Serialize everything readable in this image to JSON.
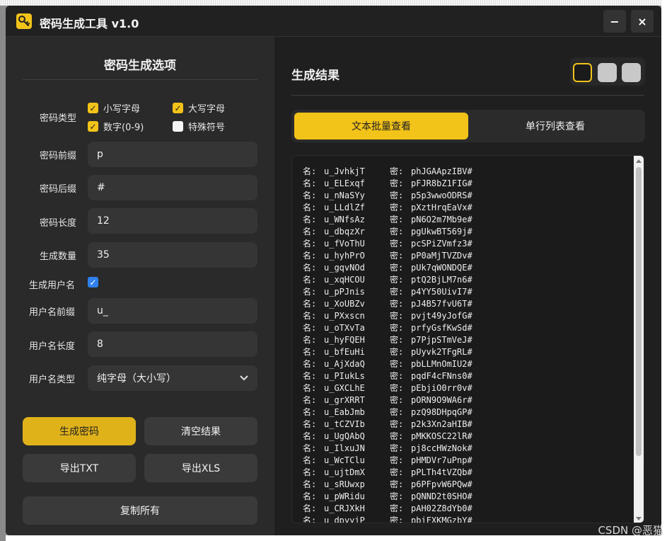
{
  "window": {
    "title": "密码生成工具 v1.0",
    "minimize": "−",
    "close": "×"
  },
  "left": {
    "title": "密码生成选项",
    "password_type_label": "密码类型",
    "checkboxes": [
      {
        "label": "小写字母",
        "checked": true
      },
      {
        "label": "大写字母",
        "checked": true
      },
      {
        "label": "数字(0-9)",
        "checked": true
      },
      {
        "label": "特殊符号",
        "checked": false
      }
    ],
    "fields": {
      "prefix_label": "密码前缀",
      "prefix_value": "p",
      "suffix_label": "密码后缀",
      "suffix_value": "#",
      "length_label": "密码长度",
      "length_value": "12",
      "count_label": "生成数量",
      "count_value": "35",
      "gen_username_label": "生成用户名",
      "gen_username_checked": true,
      "username_prefix_label": "用户名前缀",
      "username_prefix_value": "u_",
      "username_length_label": "用户名长度",
      "username_length_value": "8",
      "username_type_label": "用户名类型",
      "username_type_value": "纯字母（大小写）"
    },
    "buttons": {
      "generate": "生成密码",
      "clear": "清空结果",
      "export_txt": "导出TXT",
      "export_xls": "导出XLS",
      "copy_all": "复制所有"
    }
  },
  "right": {
    "title": "生成结果",
    "tabs": [
      "文本批量查看",
      "单行列表查看"
    ],
    "username_prefix": "名:",
    "password_prefix": "密:",
    "results": [
      [
        "u_JvhkjT",
        "phJGAApzIBV#"
      ],
      [
        "u_ELExqf",
        "pFJR8bZ1FIG#"
      ],
      [
        "u_nNaSYy",
        "p5p3wwoODRS#"
      ],
      [
        "u_LLdlZf",
        "pXztHrqEaVx#"
      ],
      [
        "u_WNfsAz",
        "pN6O2m7Mb9e#"
      ],
      [
        "u_dbqzXr",
        "pgUkwBT569j#"
      ],
      [
        "u_fVoThU",
        "pcSPiZVmfz3#"
      ],
      [
        "u_hyhPrO",
        "pP0aMjTVZDv#"
      ],
      [
        "u_gqvNOd",
        "pUk7qWONDQE#"
      ],
      [
        "u_xqHCOU",
        "ptQ2BjLM7n6#"
      ],
      [
        "u_pPJnis",
        "p4YY50UivI7#"
      ],
      [
        "u_XoUBZv",
        "pJ4B57fvU6T#"
      ],
      [
        "u_PXxscn",
        "pvjt49yJofG#"
      ],
      [
        "u_oTXvTa",
        "prfyGsfKwSd#"
      ],
      [
        "u_hyFQEH",
        "p7PjpSTmVeJ#"
      ],
      [
        "u_bfEuHi",
        "pUyvk2TFgRL#"
      ],
      [
        "u_AjXdaQ",
        "pbLLMnOmIU2#"
      ],
      [
        "u_PIukLs",
        "pqdF4cFNns0#"
      ],
      [
        "u_GXCLhE",
        "pEbjiO0rr0v#"
      ],
      [
        "u_grXRRT",
        "pORN9O9WA6r#"
      ],
      [
        "u_EabJmb",
        "pzQ98DHpqGP#"
      ],
      [
        "u_tCZVIb",
        "p2k3Xn2aHIB#"
      ],
      [
        "u_UgQAbQ",
        "pMKKOSC22lR#"
      ],
      [
        "u_IlxuJN",
        "pj8ccHWzNok#"
      ],
      [
        "u_WcTClu",
        "pHMDVr7uPnp#"
      ],
      [
        "u_ujtDmX",
        "pPLTh4tVZQb#"
      ],
      [
        "u_sRUwxp",
        "p6PFpvW6PQw#"
      ],
      [
        "u_pWRidu",
        "pQNND2t0SHO#"
      ],
      [
        "u_CRJXkH",
        "pAH02Z8dYb0#"
      ],
      [
        "u_dpyyiP",
        "pbiFXKMGzbY#"
      ]
    ]
  },
  "watermark": "CSDN @恶猫",
  "colors": {
    "accent": "#f2c319",
    "panel": "#2a2a2a",
    "result_bg": "#1b1b1b"
  }
}
